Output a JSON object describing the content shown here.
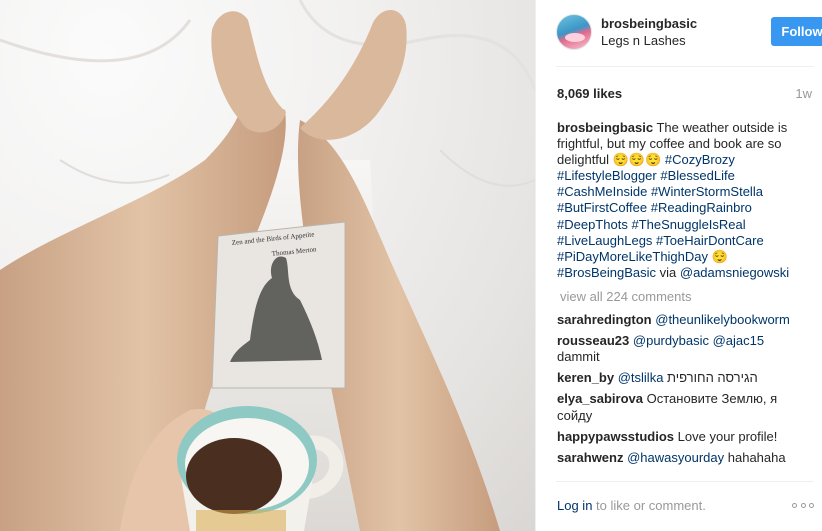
{
  "post": {
    "username": "brosbeingbasic",
    "location": "Legs n Lashes",
    "follow_label": "Follow",
    "likes": "8,069 likes",
    "time_ago": "1w",
    "book_title": "Zen and the Birds of Appetite",
    "book_author": "Thomas Merton"
  },
  "caption": {
    "username": "brosbeingbasic",
    "text": "The weather outside is frightful, but my coffee and book are so delightful 😌😌😌",
    "hashtags": [
      "#CozyBrozy",
      "#LifestyleBlogger",
      "#BlessedLife",
      "#CashMeInside",
      "#WinterStormStella",
      "#ButFirstCoffee",
      "#ReadingRainbro",
      "#DeepThots",
      "#TheSnuggleIsReal",
      "#LiveLaughLegs",
      "#ToeHairDontCare",
      "#PiDayMoreLikeThighDay"
    ],
    "emoji_after_tags": "😌",
    "final_tag": "#BrosBeingBasic",
    "via_word": "via",
    "via_user": "@adamsniegowski"
  },
  "view_all_comments": "view all 224 comments",
  "comments": [
    {
      "user": "sarahredington",
      "mention": "@theunlikelybookworm",
      "text": ""
    },
    {
      "user": "rousseau23",
      "mention": "@purdybasic @ajac15",
      "text": "dammit"
    },
    {
      "user": "keren_by",
      "mention": "@tslilka",
      "text": "הגירסה החורפית"
    },
    {
      "user": "elya_sabirova",
      "mention": "",
      "text": "Остановите Землю, я сойду"
    },
    {
      "user": "happypawsstudios",
      "mention": "",
      "text": "Love your profile!"
    },
    {
      "user": "sarahwenz",
      "mention": "@hawasyourday",
      "text": "hahahaha"
    }
  ],
  "footer": {
    "login_link": "Log in",
    "login_rest": "to like or comment.",
    "more_icon": "more-options-icon"
  },
  "colors": {
    "follow_bg": "#3897f0",
    "link": "#003569",
    "muted": "#999999"
  }
}
